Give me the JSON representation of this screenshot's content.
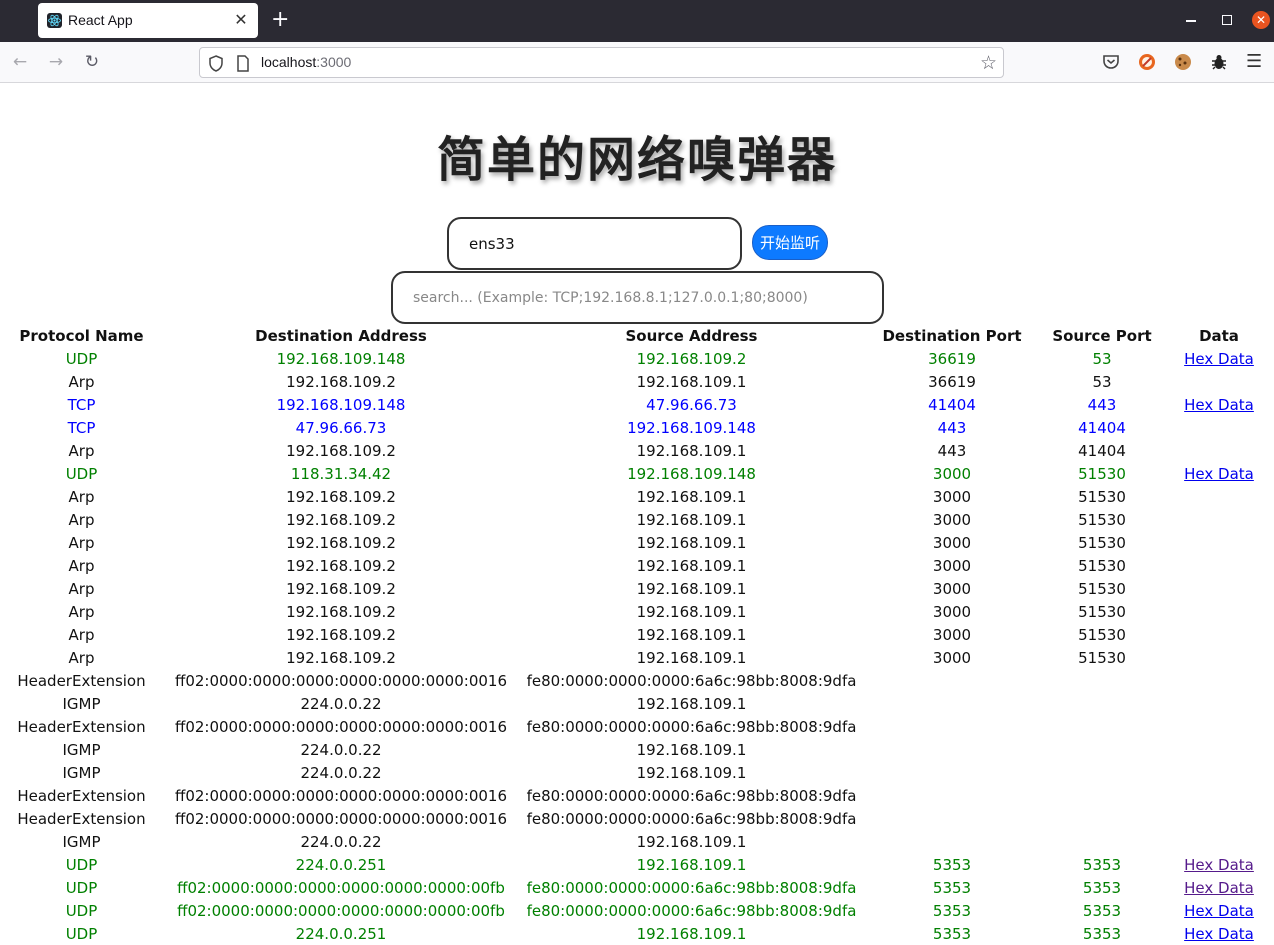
{
  "browser": {
    "tab_title": "React App",
    "tab_close": "✕",
    "new_tab": "+",
    "url_host": "localhost",
    "url_port": ":3000"
  },
  "page": {
    "title": "简单的网络嗅弹器",
    "interface_value": "ens33",
    "start_button": "开始监听",
    "search_placeholder": "search... (Example: TCP;192.168.8.1;127.0.0.1;80;8000)"
  },
  "table": {
    "headers": {
      "protocol": "Protocol Name",
      "dst_addr": "Destination Address",
      "src_addr": "Source Address",
      "dst_port": "Destination Port",
      "src_port": "Source Port",
      "data": "Data"
    },
    "rows": [
      {
        "protocol": "UDP",
        "dst": "192.168.109.148",
        "src": "192.168.109.2",
        "dport": "36619",
        "sport": "53",
        "data": "Hex Data"
      },
      {
        "protocol": "Arp",
        "dst": "192.168.109.2",
        "src": "192.168.109.1",
        "dport": "36619",
        "sport": "53",
        "data": ""
      },
      {
        "protocol": "TCP",
        "dst": "192.168.109.148",
        "src": "47.96.66.73",
        "dport": "41404",
        "sport": "443",
        "data": "Hex Data"
      },
      {
        "protocol": "TCP",
        "dst": "47.96.66.73",
        "src": "192.168.109.148",
        "dport": "443",
        "sport": "41404",
        "data": ""
      },
      {
        "protocol": "Arp",
        "dst": "192.168.109.2",
        "src": "192.168.109.1",
        "dport": "443",
        "sport": "41404",
        "data": ""
      },
      {
        "protocol": "UDP",
        "dst": "118.31.34.42",
        "src": "192.168.109.148",
        "dport": "3000",
        "sport": "51530",
        "data": "Hex Data"
      },
      {
        "protocol": "Arp",
        "dst": "192.168.109.2",
        "src": "192.168.109.1",
        "dport": "3000",
        "sport": "51530",
        "data": ""
      },
      {
        "protocol": "Arp",
        "dst": "192.168.109.2",
        "src": "192.168.109.1",
        "dport": "3000",
        "sport": "51530",
        "data": ""
      },
      {
        "protocol": "Arp",
        "dst": "192.168.109.2",
        "src": "192.168.109.1",
        "dport": "3000",
        "sport": "51530",
        "data": ""
      },
      {
        "protocol": "Arp",
        "dst": "192.168.109.2",
        "src": "192.168.109.1",
        "dport": "3000",
        "sport": "51530",
        "data": ""
      },
      {
        "protocol": "Arp",
        "dst": "192.168.109.2",
        "src": "192.168.109.1",
        "dport": "3000",
        "sport": "51530",
        "data": ""
      },
      {
        "protocol": "Arp",
        "dst": "192.168.109.2",
        "src": "192.168.109.1",
        "dport": "3000",
        "sport": "51530",
        "data": ""
      },
      {
        "protocol": "Arp",
        "dst": "192.168.109.2",
        "src": "192.168.109.1",
        "dport": "3000",
        "sport": "51530",
        "data": ""
      },
      {
        "protocol": "Arp",
        "dst": "192.168.109.2",
        "src": "192.168.109.1",
        "dport": "3000",
        "sport": "51530",
        "data": ""
      },
      {
        "protocol": "HeaderExtension",
        "dst": "ff02:0000:0000:0000:0000:0000:0000:0016",
        "src": "fe80:0000:0000:0000:6a6c:98bb:8008:9dfa",
        "dport": "",
        "sport": "",
        "data": ""
      },
      {
        "protocol": "IGMP",
        "dst": "224.0.0.22",
        "src": "192.168.109.1",
        "dport": "",
        "sport": "",
        "data": ""
      },
      {
        "protocol": "HeaderExtension",
        "dst": "ff02:0000:0000:0000:0000:0000:0000:0016",
        "src": "fe80:0000:0000:0000:6a6c:98bb:8008:9dfa",
        "dport": "",
        "sport": "",
        "data": ""
      },
      {
        "protocol": "IGMP",
        "dst": "224.0.0.22",
        "src": "192.168.109.1",
        "dport": "",
        "sport": "",
        "data": ""
      },
      {
        "protocol": "IGMP",
        "dst": "224.0.0.22",
        "src": "192.168.109.1",
        "dport": "",
        "sport": "",
        "data": ""
      },
      {
        "protocol": "HeaderExtension",
        "dst": "ff02:0000:0000:0000:0000:0000:0000:0016",
        "src": "fe80:0000:0000:0000:6a6c:98bb:8008:9dfa",
        "dport": "",
        "sport": "",
        "data": ""
      },
      {
        "protocol": "HeaderExtension",
        "dst": "ff02:0000:0000:0000:0000:0000:0000:0016",
        "src": "fe80:0000:0000:0000:6a6c:98bb:8008:9dfa",
        "dport": "",
        "sport": "",
        "data": ""
      },
      {
        "protocol": "IGMP",
        "dst": "224.0.0.22",
        "src": "192.168.109.1",
        "dport": "",
        "sport": "",
        "data": ""
      },
      {
        "protocol": "UDP",
        "dst": "224.0.0.251",
        "src": "192.168.109.1",
        "dport": "5353",
        "sport": "5353",
        "data": "Hex Data",
        "visited": true
      },
      {
        "protocol": "UDP",
        "dst": "ff02:0000:0000:0000:0000:0000:0000:00fb",
        "src": "fe80:0000:0000:0000:6a6c:98bb:8008:9dfa",
        "dport": "5353",
        "sport": "5353",
        "data": "Hex Data",
        "visited": true
      },
      {
        "protocol": "UDP",
        "dst": "ff02:0000:0000:0000:0000:0000:0000:00fb",
        "src": "fe80:0000:0000:0000:6a6c:98bb:8008:9dfa",
        "dport": "5353",
        "sport": "5353",
        "data": "Hex Data"
      },
      {
        "protocol": "UDP",
        "dst": "224.0.0.251",
        "src": "192.168.109.1",
        "dport": "5353",
        "sport": "5353",
        "data": "Hex Data"
      }
    ]
  },
  "colors": {
    "udp": "#008000",
    "tcp": "#0000ff",
    "other": "#111111",
    "button": "#0d7aff"
  }
}
